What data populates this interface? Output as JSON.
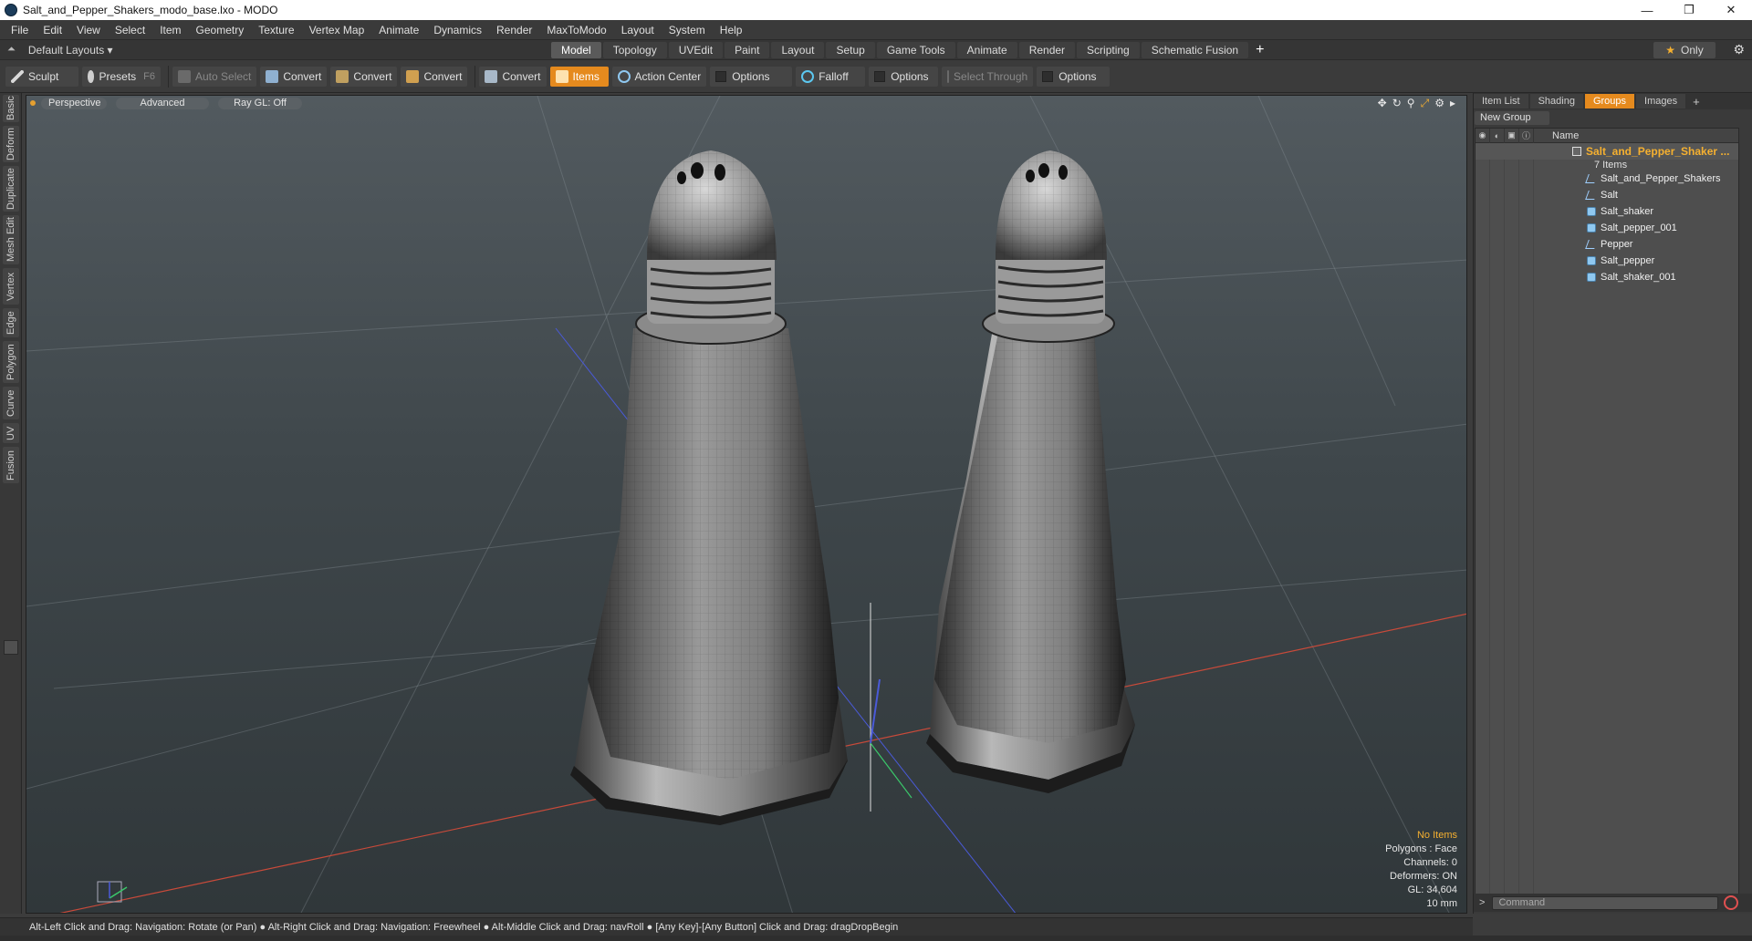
{
  "window": {
    "title": "Salt_and_Pepper_Shakers_modo_base.lxo - MODO",
    "minimize": "—",
    "maximize": "❐",
    "close": "✕"
  },
  "menu": [
    "File",
    "Edit",
    "View",
    "Select",
    "Item",
    "Geometry",
    "Texture",
    "Vertex Map",
    "Animate",
    "Dynamics",
    "Render",
    "MaxToModo",
    "Layout",
    "System",
    "Help"
  ],
  "layout_bar": {
    "layout_select": "Default Layouts ▾",
    "tabs": [
      "Model",
      "Topology",
      "UVEdit",
      "Paint",
      "Layout",
      "Setup",
      "Game Tools",
      "Animate",
      "Render",
      "Scripting",
      "Schematic Fusion"
    ],
    "active_tab": "Model",
    "only_label": "Only"
  },
  "toolbar": {
    "sculpt": "Sculpt",
    "presets": "Presets",
    "presets_shortcut": "F6",
    "auto_select": "Auto Select",
    "convert1": "Convert",
    "convert2": "Convert",
    "convert3": "Convert",
    "convert4": "Convert",
    "items": "Items",
    "action_center": "Action Center",
    "options1": "Options",
    "falloff": "Falloff",
    "options2": "Options",
    "select_through": "Select Through",
    "options3": "Options"
  },
  "left_tabs": [
    "Basic",
    "Deform",
    "Duplicate",
    "Mesh Edit",
    "Vertex",
    "Edge",
    "Polygon",
    "Curve",
    "UV",
    "Fusion"
  ],
  "viewport": {
    "view": "Perspective",
    "style": "Advanced",
    "raygl": "Ray GL: Off",
    "stats": {
      "items": "No Items",
      "polygons": "Polygons : Face",
      "channels": "Channels: 0",
      "deformers": "Deformers: ON",
      "gl": "GL: 34,604",
      "scale": "10 mm"
    }
  },
  "right_panel": {
    "tabs": [
      "Item List",
      "Shading",
      "Groups",
      "Images"
    ],
    "active_tab": "Groups",
    "new_group": "New Group",
    "name_col": "Name",
    "group_name": "Salt_and_Pepper_Shaker ...",
    "group_count": "7 Items",
    "items": [
      {
        "name": "Salt_and_Pepper_Shakers",
        "type": "locator"
      },
      {
        "name": "Salt",
        "type": "locator"
      },
      {
        "name": "Salt_shaker",
        "type": "mesh"
      },
      {
        "name": "Salt_pepper_001",
        "type": "mesh"
      },
      {
        "name": "Pepper",
        "type": "locator"
      },
      {
        "name": "Salt_pepper",
        "type": "mesh"
      },
      {
        "name": "Salt_shaker_001",
        "type": "mesh"
      }
    ],
    "command_prompt": ">",
    "command_placeholder": "Command"
  },
  "statusbar": "Alt-Left Click and Drag: Navigation: Rotate (or Pan) ● Alt-Right Click and Drag: Navigation: Freewheel ● Alt-Middle Click and Drag: navRoll ● [Any Key]-[Any Button] Click and Drag: dragDropBegin",
  "colors": {
    "accent": "#e58a1e",
    "group_label": "#f5b030",
    "x_axis": "#c84a3a",
    "z_axis": "#4a5ad8",
    "y_axis": "#3ac86a"
  }
}
